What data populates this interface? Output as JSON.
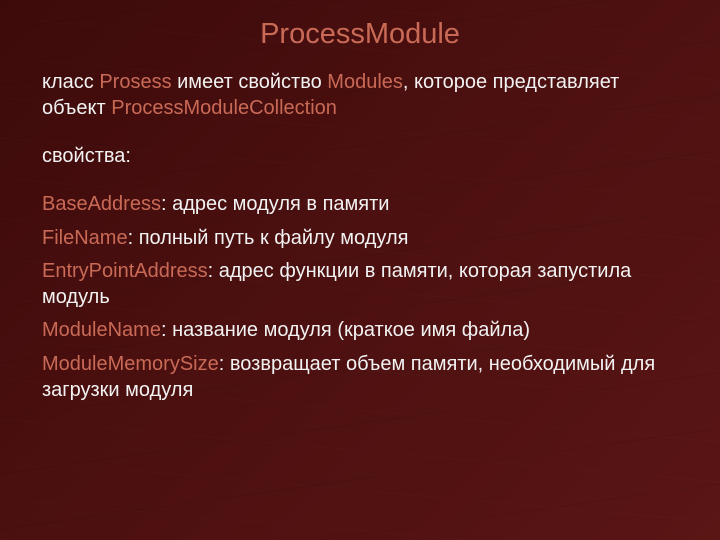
{
  "title": "ProcessModule",
  "intro": {
    "t1": "класс ",
    "h1": "Prosess",
    "t2": " имеет свойство ",
    "h2": "Modules",
    "t3": ", которое представляет объект ",
    "h3": "ProcessModuleCollection"
  },
  "subheader": "свойства:",
  "properties": [
    {
      "name": "BaseAddress",
      "desc": ": адрес модуля в памяти"
    },
    {
      "name": "FileName",
      "desc": ": полный путь к файлу модуля"
    },
    {
      "name": "EntryPointAddress",
      "desc": ": адрес функции в памяти, которая запустила модуль"
    },
    {
      "name": "ModuleName",
      "desc": ": название модуля (краткое имя файла)"
    },
    {
      "name": "ModuleMemorySize",
      "desc": ": возвращает объем памяти, необходимый для загрузки модуля"
    }
  ]
}
